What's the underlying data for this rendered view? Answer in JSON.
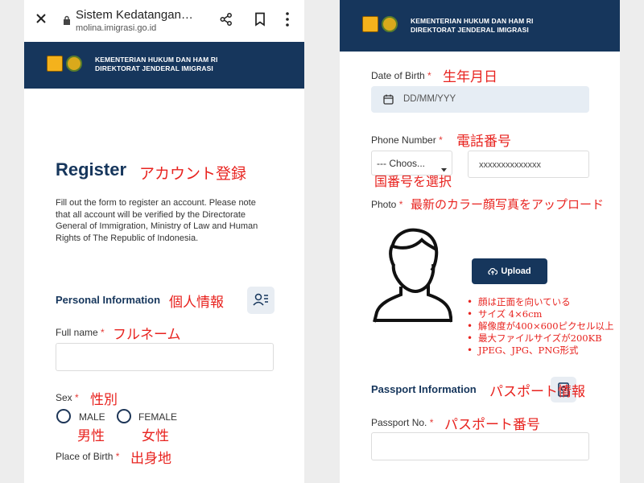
{
  "browser": {
    "site_title": "Sistem Kedatangan…",
    "url": "molina.imigrasi.go.id",
    "close_icon": "close-icon",
    "lock_icon": "lock-icon",
    "share_icon": "share-icon",
    "bookmark_icon": "bookmark-icon",
    "menu_icon": "more-vert-icon"
  },
  "header": {
    "line1": "KEMENTERIAN HUKUM DAN HAM RI",
    "line2": "DIREKTORAT JENDERAL IMIGRASI"
  },
  "register": {
    "title": "Register",
    "title_jp": "アカウント登録",
    "description": "Fill out the form to register an account. Please note that all account will be verified by the Directorate General of Immigration, Ministry of Law and Human Rights of The Republic of Indonesia."
  },
  "personal": {
    "section_title": "Personal Information",
    "section_jp": "個人情報",
    "full_name_label": "Full name",
    "full_name_jp": "フルネーム",
    "sex_label": "Sex",
    "sex_jp": "性別",
    "male_label": "MALE",
    "male_jp": "男性",
    "female_label": "FEMALE",
    "female_jp": "女性",
    "place_of_birth_label": "Place of Birth",
    "place_of_birth_jp": "出身地",
    "required_mark": "*"
  },
  "right": {
    "dob_label": "Date of Birth",
    "dob_jp": "生年月日",
    "dob_placeholder": "DD/MM/YYY",
    "phone_label": "Phone Number",
    "phone_jp": "電話番号",
    "country_select": "--- Choos...",
    "country_jp": "国番号を選択",
    "phone_placeholder": "xxxxxxxxxxxxxx",
    "photo_label": "Photo",
    "photo_jp": "最新のカラー顔写真をアップロード",
    "upload_label": "Upload",
    "photo_rules": [
      "顔は正面を向いている",
      "サイズ 4×6cm",
      "解像度が400×600ピクセル以上",
      "最大ファイルサイズが200KB",
      "JPEG、JPG、PNG形式"
    ],
    "passport_section": "Passport Information",
    "passport_section_jp": "パスポート情報",
    "passport_no_label": "Passport No.",
    "passport_no_jp": "パスポート番号"
  }
}
